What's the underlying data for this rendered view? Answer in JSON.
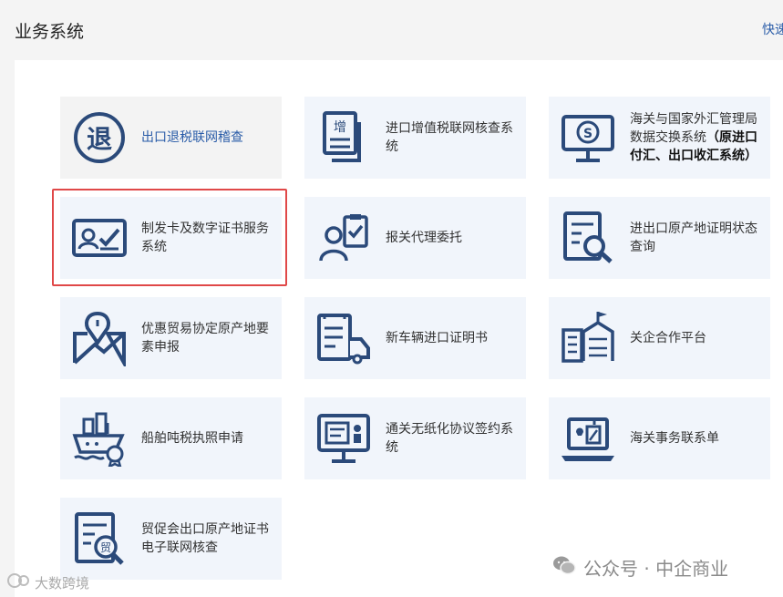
{
  "header": {
    "title": "业务系统",
    "quick_link": "快速"
  },
  "tiles": [
    {
      "id": "export-refund",
      "label": "出口退税联网稽查",
      "icon": "refund-seal-icon"
    },
    {
      "id": "vat-check",
      "label": "进口增值税联网核查系统",
      "icon": "document-stack-icon"
    },
    {
      "id": "forex",
      "label_plain": "海关与国家外汇管理局数据交换系统",
      "label_bold": "（原进口付汇、出口收汇系统）",
      "icon": "monitor-dollar-icon"
    },
    {
      "id": "card-cert",
      "label": "制发卡及数字证书服务系统",
      "icon": "id-card-check-icon"
    },
    {
      "id": "agent",
      "label": "报关代理委托",
      "icon": "person-clipboard-icon"
    },
    {
      "id": "origin-status",
      "label": "进出口原产地证明状态查询",
      "icon": "document-search-icon"
    },
    {
      "id": "preferential",
      "label": "优惠贸易协定原产地要素申报",
      "icon": "map-pin-icon"
    },
    {
      "id": "vehicle",
      "label": "新车辆进口证明书",
      "icon": "truck-document-icon"
    },
    {
      "id": "cooperation",
      "label": "关企合作平台",
      "icon": "building-flag-icon"
    },
    {
      "id": "tonnage",
      "label": "船舶吨税执照申请",
      "icon": "ship-badge-icon"
    },
    {
      "id": "paperless",
      "label": "通关无纸化协议签约系统",
      "icon": "monitor-contract-icon"
    },
    {
      "id": "contact",
      "label": "海关事务联系单",
      "icon": "laptop-document-icon"
    },
    {
      "id": "ccpit",
      "label": "贸促会出口原产地证书电子联网核查",
      "icon": "certificate-search-icon"
    }
  ],
  "watermark": {
    "text": "公众号 · 中企商业",
    "brand": "大数跨境"
  },
  "colors": {
    "accent": "#2a5ca8",
    "icon": "#2b4a7a",
    "highlight": "#e04848",
    "tile_bg": "#f1f5fb"
  }
}
